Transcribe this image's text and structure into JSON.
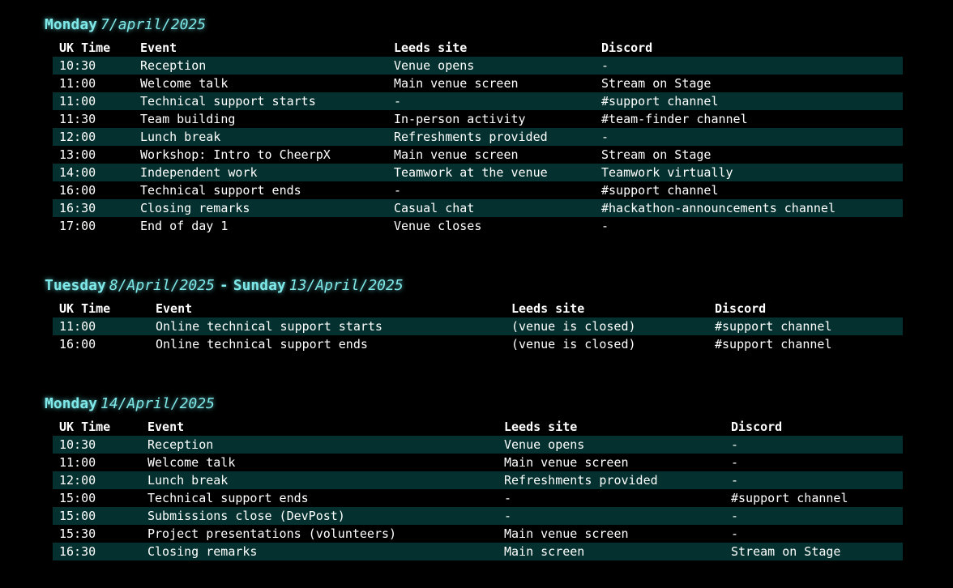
{
  "days": [
    {
      "day_name": "Monday",
      "date": "7/april/2025",
      "columns": [
        "UK Time",
        "Event",
        "Leeds site",
        "Discord"
      ],
      "rows": [
        [
          "10:30",
          "Reception",
          "Venue opens",
          "-"
        ],
        [
          "11:00",
          "Welcome talk",
          "Main venue screen",
          "Stream on Stage"
        ],
        [
          "11:00",
          "Technical support starts",
          "-",
          "#support channel"
        ],
        [
          "11:30",
          "Team building",
          "In-person activity",
          "#team-finder channel"
        ],
        [
          "12:00",
          "Lunch break",
          "Refreshments provided",
          "-"
        ],
        [
          "13:00",
          "Workshop: Intro to CheerpX",
          "Main venue screen",
          "Stream on Stage"
        ],
        [
          "14:00",
          "Independent work",
          "Teamwork at the venue",
          "Teamwork virtually"
        ],
        [
          "16:00",
          "Technical support ends",
          "-",
          "#support channel"
        ],
        [
          "16:30",
          "Closing remarks",
          "Casual chat",
          "#hackathon-announcements channel"
        ],
        [
          "17:00",
          "End of day 1",
          "Venue closes",
          "-"
        ]
      ]
    },
    {
      "day_name": "Tuesday",
      "date": "8/April/2025",
      "separator": "-",
      "day_name_2": "Sunday",
      "date_2": "13/April/2025",
      "columns": [
        "UK Time",
        "Event",
        "Leeds site",
        "Discord"
      ],
      "rows": [
        [
          "11:00",
          "Online technical support starts",
          "(venue is closed)",
          "#support channel"
        ],
        [
          "16:00",
          "Online technical support ends",
          "(venue is closed)",
          "#support channel"
        ]
      ]
    },
    {
      "day_name": "Monday",
      "date": "14/April/2025",
      "columns": [
        "UK Time",
        "Event",
        "Leeds site",
        "Discord"
      ],
      "rows": [
        [
          "10:30",
          "Reception",
          "Venue opens",
          "-"
        ],
        [
          "11:00",
          "Welcome talk",
          "Main venue screen",
          "-"
        ],
        [
          "12:00",
          "Lunch break",
          "Refreshments provided",
          "-"
        ],
        [
          "15:00",
          "Technical support ends",
          "-",
          "#support channel"
        ],
        [
          "15:00",
          "Submissions close (DevPost)",
          "-",
          "-"
        ],
        [
          "15:30",
          "Project presentations (volunteers)",
          "Main venue screen",
          "-"
        ],
        [
          "16:30",
          "Closing remarks",
          "Main screen",
          "Stream on Stage"
        ]
      ]
    }
  ],
  "colors": {
    "background": "#000000",
    "heading": "#7fe8e8",
    "row_shade": "#04312f",
    "text": "#ffffff"
  }
}
